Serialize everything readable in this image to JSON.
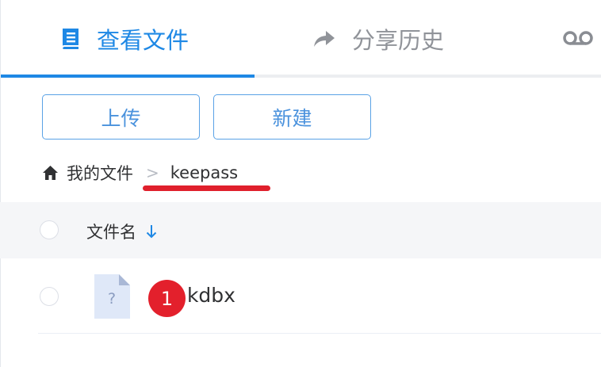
{
  "tabs": [
    {
      "label": "查看文件",
      "icon": "document-icon",
      "active": true
    },
    {
      "label": "分享历史",
      "icon": "share-arrow-icon",
      "active": false
    }
  ],
  "more_icon": "voicemail-icon",
  "actions": {
    "upload_label": "上传",
    "new_label": "新建"
  },
  "breadcrumb": {
    "root_icon": "home-icon",
    "root_label": "我的文件",
    "separator": ">",
    "current": "keepass"
  },
  "table": {
    "column_name_label": "文件名",
    "sort_icon": "arrow-down-icon",
    "rows": [
      {
        "name": ".kdbx",
        "icon": "unknown-file-icon"
      }
    ]
  },
  "annotation": {
    "badge_number": "1",
    "color": "#e3202c",
    "underline_color": "#e0202c"
  },
  "colors": {
    "accent": "#1e88e5",
    "inactive": "#909399",
    "button_text": "#4a92dd"
  }
}
